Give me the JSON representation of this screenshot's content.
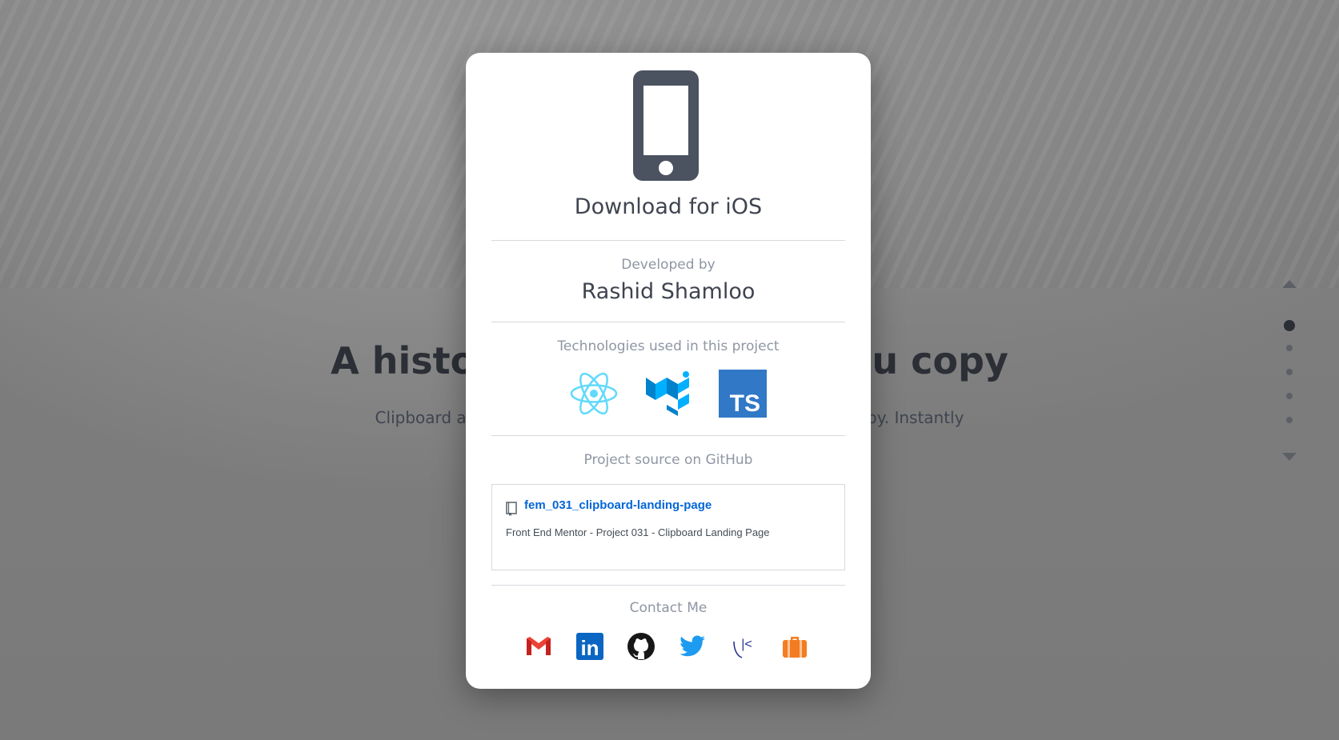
{
  "background": {
    "hero_title": "A history of everything you copy",
    "hero_subtitle": "Clipboard allows you to track and organize everything you copy. Instantly"
  },
  "pager": {
    "dots": 5,
    "active_index": 0
  },
  "modal": {
    "title": "Download for iOS",
    "developed_by_label": "Developed by",
    "developer_name": "Rashid Shamloo",
    "technologies_label": "Technologies used in this project",
    "technologies": [
      {
        "name": "React",
        "icon": "react-icon",
        "color": "#61dafb"
      },
      {
        "name": "MUI",
        "icon": "mui-icon",
        "color": "#007fff"
      },
      {
        "name": "TypeScript",
        "icon": "typescript-icon",
        "color": "#3178c6",
        "text": "TS"
      }
    ],
    "source_label": "Project source on GitHub",
    "repo": {
      "name": "fem_031_clipboard-landing-page",
      "description": "Front End Mentor - Project 031 - Clipboard Landing Page",
      "link_color": "#0366d6"
    },
    "contact_label": "Contact Me",
    "contacts": [
      {
        "name": "Gmail",
        "icon": "gmail-icon",
        "color": "#ea4335"
      },
      {
        "name": "LinkedIn",
        "icon": "linkedin-icon",
        "color": "#0a66c2",
        "text": "in"
      },
      {
        "name": "GitHub",
        "icon": "github-icon",
        "color": "#181717"
      },
      {
        "name": "Twitter",
        "icon": "twitter-icon",
        "color": "#1d9bf0"
      },
      {
        "name": "Kaggle",
        "icon": "kaggle-icon",
        "color": "#283593",
        "text": "|<"
      },
      {
        "name": "Portfolio",
        "icon": "briefcase-icon",
        "color": "#f47c20"
      }
    ]
  }
}
